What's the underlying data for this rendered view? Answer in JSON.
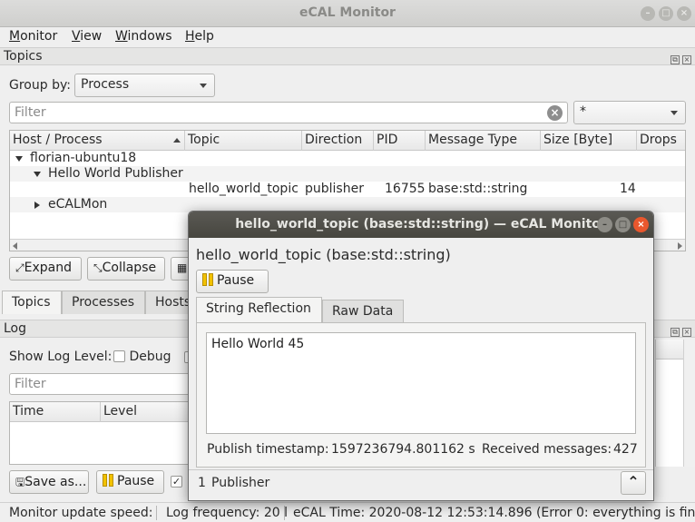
{
  "app": {
    "title": "eCAL Monitor",
    "window_buttons": [
      "–",
      "□",
      "×"
    ]
  },
  "menubar": {
    "items": [
      {
        "label": "Monitor",
        "mnemonic": "M",
        "rest": "onitor"
      },
      {
        "label": "View",
        "mnemonic": "V",
        "rest": "iew"
      },
      {
        "label": "Windows",
        "mnemonic": "W",
        "rest": "indows"
      },
      {
        "label": "Help",
        "mnemonic": "H",
        "rest": "elp"
      }
    ]
  },
  "topics_dock": {
    "title": "Topics",
    "group_by_label": "Group by:",
    "group_by_value": "Process",
    "filter_placeholder": "Filter",
    "filter_column_value": "*",
    "columns": [
      "Host / Process",
      "Topic",
      "Direction",
      "PID",
      "Message Type",
      "Size [Byte]",
      "Drops"
    ],
    "tree": {
      "host": "florian-ubuntu18",
      "process": "Hello World Publisher",
      "topic_row": {
        "topic": "hello_world_topic",
        "direction": "publisher",
        "pid": "16755",
        "message_type": "base:std::string",
        "size": "14"
      },
      "other_process": "eCALMon"
    },
    "buttons": {
      "expand": "Expand",
      "collapse": "Collapse"
    }
  },
  "main_tabs": [
    "Topics",
    "Processes",
    "Hosts"
  ],
  "log_dock": {
    "title": "Log",
    "show_level_label": "Show Log Level:",
    "debug_label": "Debug",
    "filter_placeholder": "Filter",
    "columns": [
      "Time",
      "Level"
    ],
    "buttons": {
      "save": "Save as...",
      "pause": "Pause"
    }
  },
  "statusbar": {
    "update_speed": "Monitor update speed: ",
    "log_frequency": "Log frequency: 20 l",
    "ecal_time": "eCAL Time: 2020-08-12 12:53:14.896 (Error 0: everything is fin"
  },
  "topic_window": {
    "title": "hello_world_topic (base:std::string) — eCAL Monitor",
    "heading": "hello_world_topic (base:std::string)",
    "pause_label": "Pause",
    "tabs": [
      "String Reflection",
      "Raw Data"
    ],
    "active_tab": "String Reflection",
    "content": "Hello World 45",
    "publish_timestamp_label": "Publish timestamp:",
    "publish_timestamp_value": "1597236794.801162 s",
    "received_label": "Received messages:",
    "received_value": "427",
    "publishers_count": "1",
    "publishers_label": "Publisher"
  },
  "colors": {
    "accent_close": "#e9572d",
    "pause_icon": "#f2c200",
    "title_dark": "#47463f"
  }
}
